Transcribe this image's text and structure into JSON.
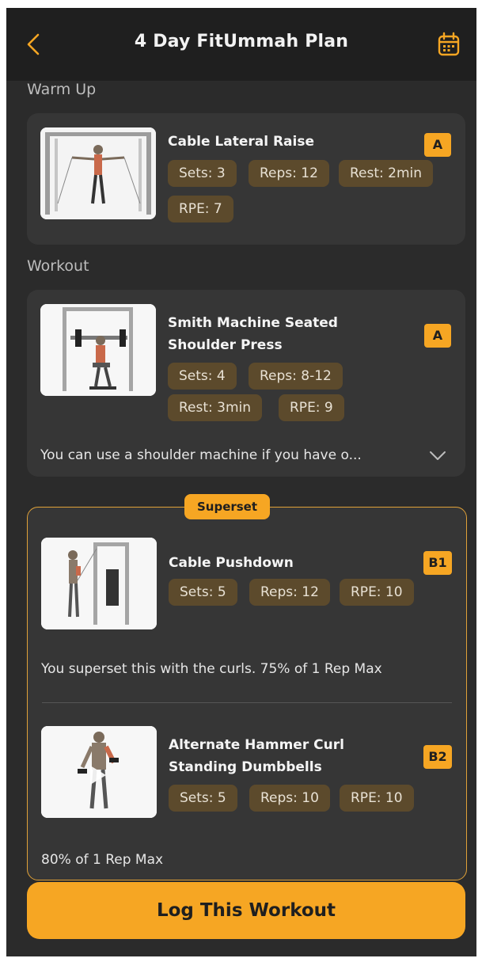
{
  "header": {
    "title": "4 Day FitUmmah Plan",
    "back_icon": "chevron-left-icon",
    "calendar_icon": "calendar-icon"
  },
  "colors": {
    "accent": "#f6a623",
    "chip_bg": "#5c4a2c",
    "background": "#2b2b2b",
    "card": "#363636"
  },
  "sections": {
    "warmup": "Warm Up",
    "workout": "Workout"
  },
  "warmup_exercise": {
    "name": "Cable Lateral Raise",
    "tag": "A",
    "sets": "Sets: 3",
    "reps": "Reps: 12",
    "rest": "Rest: 2min",
    "rpe": "RPE: 7"
  },
  "workout_exercise": {
    "name_line1": "Smith Machine Seated",
    "name_line2": "Shoulder Press",
    "tag": "A",
    "sets": "Sets: 4",
    "reps": "Reps: 8-12",
    "rest": "Rest: 3min",
    "rpe": "RPE: 9",
    "note": "You can use a shoulder machine if you have o..."
  },
  "superset": {
    "label": "Superset",
    "ex1": {
      "name": "Cable Pushdown",
      "tag": "B1",
      "sets": "Sets: 5",
      "reps": "Reps: 12",
      "rpe": "RPE: 10",
      "note": "You superset this with the curls. 75% of 1 Rep Max"
    },
    "ex2": {
      "name_line1": "Alternate Hammer Curl",
      "name_line2": "Standing Dumbbells",
      "tag": "B2",
      "sets": "Sets: 5",
      "reps": "Reps: 10",
      "rpe": "RPE: 10",
      "note": "80% of 1 Rep Max"
    }
  },
  "footer": {
    "log_button": "Log This Workout"
  }
}
